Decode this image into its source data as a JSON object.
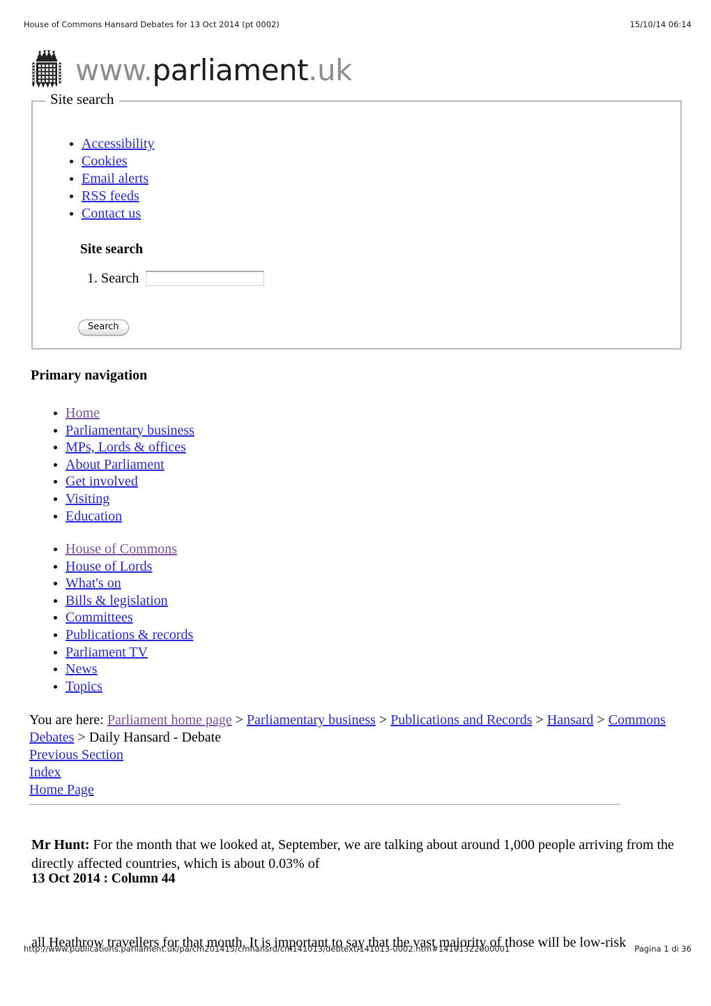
{
  "print_header": {
    "title": "House of Commons Hansard Debates for 13 Oct 2014 (pt 0002)",
    "timestamp": "15/10/14 06:14"
  },
  "print_footer": {
    "url": "http://www.publications.parliament.uk/pa/cm201415/cmhansrd/cm141013/debtext/141013-0002.htm#14101322000001",
    "page_label": "Pagina 1 di 36"
  },
  "logo": {
    "icon": "portcullis-icon",
    "wordmark_prefix": "www.",
    "wordmark_main": "parliament",
    "wordmark_suffix": ".uk"
  },
  "site_search": {
    "legend": "Site search",
    "utility_links": [
      {
        "label": "Accessibility",
        "visited": false
      },
      {
        "label": "Cookies",
        "visited": false
      },
      {
        "label": "Email alerts",
        "visited": false
      },
      {
        "label": "RSS feeds",
        "visited": false
      },
      {
        "label": "Contact us",
        "visited": false
      }
    ],
    "heading": "Site search",
    "field_label": "Search",
    "field_value": "",
    "field_placeholder": "",
    "submit_label": "Search"
  },
  "primary_navigation": {
    "heading": "Primary navigation",
    "group_one": [
      {
        "label": "Home",
        "visited": true
      },
      {
        "label": "Parliamentary business",
        "visited": false
      },
      {
        "label": "MPs, Lords & offices",
        "visited": false
      },
      {
        "label": "About Parliament",
        "visited": false
      },
      {
        "label": "Get involved",
        "visited": false
      },
      {
        "label": "Visiting",
        "visited": false
      },
      {
        "label": "Education",
        "visited": false
      }
    ],
    "group_two": [
      {
        "label": "House of Commons",
        "visited": true
      },
      {
        "label": "House of Lords",
        "visited": false
      },
      {
        "label": "What's on",
        "visited": false
      },
      {
        "label": "Bills & legislation",
        "visited": false
      },
      {
        "label": "Committees",
        "visited": false
      },
      {
        "label": "Publications & records",
        "visited": false
      },
      {
        "label": "Parliament TV",
        "visited": false
      },
      {
        "label": "News",
        "visited": false
      },
      {
        "label": "Topics",
        "visited": false
      }
    ]
  },
  "breadcrumb": {
    "prefix": "You are here: ",
    "separator": " > ",
    "items": [
      {
        "label": "Parliament home page",
        "link": true,
        "visited": true
      },
      {
        "label": "Parliamentary business",
        "link": true,
        "visited": false
      },
      {
        "label": "Publications and Records",
        "link": true,
        "visited": false
      },
      {
        "label": "Hansard",
        "link": true,
        "visited": false
      },
      {
        "label": "Commons Debates",
        "link": true,
        "visited": false
      },
      {
        "label": "Daily Hansard - Debate",
        "link": false,
        "visited": false
      }
    ]
  },
  "section_links": [
    {
      "label": "Previous Section",
      "visited": false
    },
    {
      "label": "Index",
      "visited": false
    },
    {
      "label": "Home Page",
      "visited": false
    }
  ],
  "content": {
    "paragraph_one_speaker": "Mr Hunt:",
    "paragraph_one_text": " For the month that we looked at, September, we are talking about around 1,000 people arriving from the directly affected countries, which is about 0.03% of",
    "column_heading": "13 Oct 2014 : Column 44",
    "paragraph_two_text": "all Heathrow travellers for that month. It is important to say that the vast majority of those will be low-risk"
  },
  "colors": {
    "link": "#2727d6",
    "visited_link": "#7c4d9e",
    "fieldset_border": "#b9b9b9",
    "rule": "#c9c9c9",
    "wordmark_grey": "#8d8d8d",
    "wordmark_dark": "#1c1c1c"
  }
}
